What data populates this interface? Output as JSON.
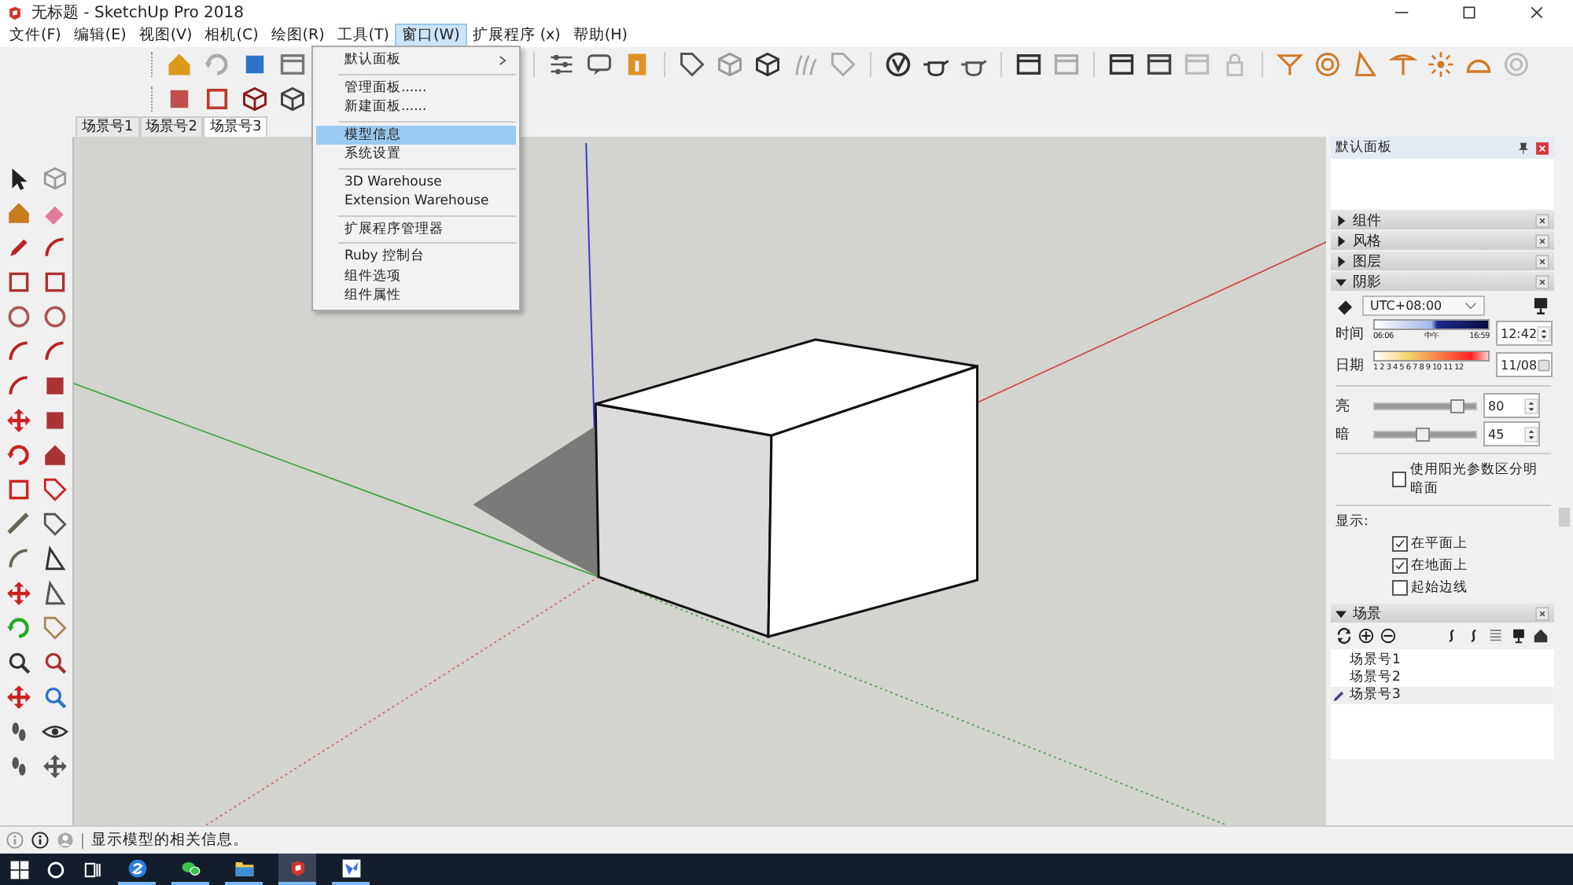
{
  "window": {
    "title": "无标题 - SketchUp Pro 2018"
  },
  "menu_bar": [
    {
      "label": "文件(F)",
      "selected": false
    },
    {
      "label": "编辑(E)",
      "selected": false
    },
    {
      "label": "视图(V)",
      "selected": false
    },
    {
      "label": "相机(C)",
      "selected": false
    },
    {
      "label": "绘图(R)",
      "selected": false
    },
    {
      "label": "工具(T)",
      "selected": false
    },
    {
      "label": "窗口(W)",
      "selected": true
    },
    {
      "label": "扩展程序 (x)",
      "selected": false
    },
    {
      "label": "帮助(H)",
      "selected": false
    }
  ],
  "window_menu": {
    "groups": [
      [
        {
          "label": "默认面板",
          "selected": false,
          "submenu": true
        }
      ],
      [
        {
          "label": "管理面板......",
          "selected": false,
          "submenu": false
        },
        {
          "label": "新建面板......",
          "selected": false,
          "submenu": false
        }
      ],
      [
        {
          "label": "模型信息",
          "selected": true,
          "submenu": false
        },
        {
          "label": "系统设置",
          "selected": false,
          "submenu": false
        }
      ],
      [
        {
          "label": "3D Warehouse",
          "selected": false,
          "submenu": false
        },
        {
          "label": "Extension Warehouse",
          "selected": false,
          "submenu": false
        }
      ],
      [
        {
          "label": "扩展程序管理器",
          "selected": false,
          "submenu": false
        }
      ],
      [
        {
          "label": "Ruby 控制台",
          "selected": false,
          "submenu": false
        },
        {
          "label": "组件选项",
          "selected": false,
          "submenu": false
        },
        {
          "label": "组件属性",
          "selected": false,
          "submenu": false
        }
      ]
    ]
  },
  "scene_tabs": [
    {
      "label": "场景号1",
      "selected": false
    },
    {
      "label": "场景号2",
      "selected": false
    },
    {
      "label": "场景号3",
      "selected": true
    }
  ],
  "tray": {
    "title": "默认面板",
    "sections": [
      {
        "title": "组件",
        "expanded": false
      },
      {
        "title": "风格",
        "expanded": false
      },
      {
        "title": "图层",
        "expanded": false
      },
      {
        "kind": "shadows",
        "title": "阴影",
        "expanded": true
      },
      {
        "kind": "scenes",
        "title": "场景",
        "expanded": true
      }
    ],
    "shadows": {
      "timezone": "UTC+08:00",
      "rows": [
        {
          "kind": "time",
          "label": "时间",
          "scale": [
            "06:06",
            "中午",
            "16:59"
          ],
          "value": "12:42"
        },
        {
          "kind": "date",
          "label": "日期",
          "scale": [
            "1 2 3 4 5 6 7 8 9 10 11 12"
          ],
          "value": "11/08"
        }
      ],
      "light": [
        {
          "label": "亮",
          "level": 0.8,
          "value": "80"
        },
        {
          "label": "暗",
          "level": 0.45,
          "value": "45"
        }
      ],
      "sun_shading": {
        "label": "使用阳光参数区分明暗面",
        "checked": false
      },
      "display_label": "显示:",
      "display": [
        {
          "label": "在平面上",
          "checked": true
        },
        {
          "label": "在地面上",
          "checked": true
        },
        {
          "label": "起始边线",
          "checked": false
        }
      ]
    },
    "scenes": [
      {
        "label": "场景号1",
        "selected": false
      },
      {
        "label": "场景号2",
        "selected": false
      },
      {
        "label": "场景号3",
        "selected": true
      }
    ]
  },
  "status_bar": {
    "text": "显示模型的相关信息。"
  },
  "taskbar": {
    "apps": [
      {
        "active": false,
        "running": true
      },
      {
        "active": false,
        "running": true
      },
      {
        "active": false,
        "running": true
      },
      {
        "active": true,
        "running": true
      },
      {
        "active": false,
        "running": true
      }
    ]
  }
}
